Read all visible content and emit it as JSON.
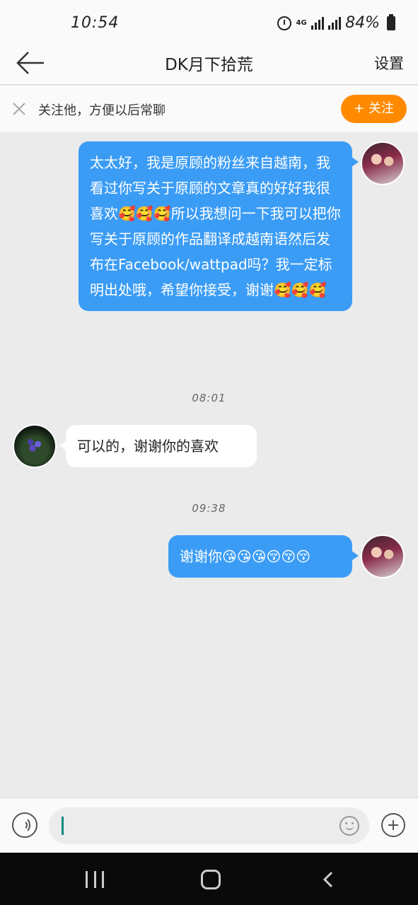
{
  "status_bar": {
    "time": "10:54",
    "network": "4G",
    "battery": "84%"
  },
  "header": {
    "title": "DK月下拾荒",
    "settings_label": "设置",
    "back_icon": "arrow-left-icon"
  },
  "follow_banner": {
    "text": "关注他，方便以后常聊",
    "button_label": "+ 关注",
    "close_icon": "close-icon"
  },
  "messages": [
    {
      "sender": "me",
      "text": "太太好，我是原顾的粉丝来自越南，我看过你写关于原顾的文章真的好好我很喜欢🥰🥰🥰所以我想问一下我可以把你写关于原顾的作品翻译成越南语然后发布在Facebook/wattpad吗？我一定标明出处哦，希望你接受，谢谢🥰🥰🥰"
    },
    {
      "timestamp": "08:01"
    },
    {
      "sender": "other",
      "text": "可以的，谢谢你的喜欢"
    },
    {
      "timestamp": "09:38"
    },
    {
      "sender": "me",
      "text": "谢谢你😘😘😘😚😚😚"
    }
  ],
  "input_bar": {
    "value": "",
    "voice_icon": "voice-icon",
    "emoji_icon": "emoji-icon",
    "plus_icon": "plus-icon"
  },
  "colors": {
    "my_bubble": "#3b9cf5",
    "other_bubble": "#ffffff",
    "follow_button": "#ff8a00",
    "background": "#ebebeb"
  }
}
